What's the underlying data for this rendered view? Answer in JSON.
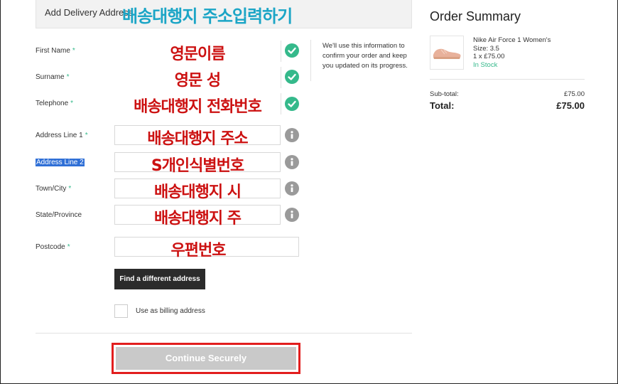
{
  "header": {
    "title": "Add Delivery Address",
    "overlay": "배송대행지 주소입력하기"
  },
  "form": {
    "required_mark": "*",
    "fields": [
      {
        "label": "First Name",
        "required": true,
        "overlay": "영문이름",
        "status": "check-icon"
      },
      {
        "label": "Surname",
        "required": true,
        "overlay": "영문 성",
        "status": "check-icon"
      },
      {
        "label": "Telephone",
        "required": true,
        "overlay": "배송대행지 전화번호",
        "status": "check-icon"
      },
      {
        "label": "Address Line 1",
        "required": true,
        "overlay": "배송대행지 주소",
        "status": "info-icon"
      },
      {
        "label": "Address Line 2",
        "required": false,
        "overlay": "S개인식별번호",
        "status": "info-icon"
      },
      {
        "label": "Town/City",
        "required": true,
        "overlay": "배송대행지 시",
        "status": "info-icon"
      },
      {
        "label": "State/Province",
        "required": false,
        "overlay": "배송대행지 주",
        "status": "info-icon"
      },
      {
        "label": "Postcode",
        "required": true,
        "overlay": "우편번호",
        "status": ""
      }
    ],
    "info_note": "We'll use this information to confirm your order and keep you updated on its progress.",
    "find_button": "Find a different address",
    "billing_checkbox_label": "Use as billing address",
    "continue_button": "Continue Securely"
  },
  "summary": {
    "title": "Order Summary",
    "product": {
      "name": "Nike Air Force 1 Women's",
      "size": "Size: 3.5",
      "qty_price": "1 x £75.00",
      "stock": "In Stock"
    },
    "subtotal_label": "Sub-total:",
    "subtotal_value": "£75.00",
    "total_label": "Total:",
    "total_value": "£75.00"
  },
  "colors": {
    "accent_green": "#35b98b",
    "overlay_red": "#cc1111",
    "overlay_blue": "#1ba5c6",
    "highlight_outline": "#e21e1e"
  }
}
